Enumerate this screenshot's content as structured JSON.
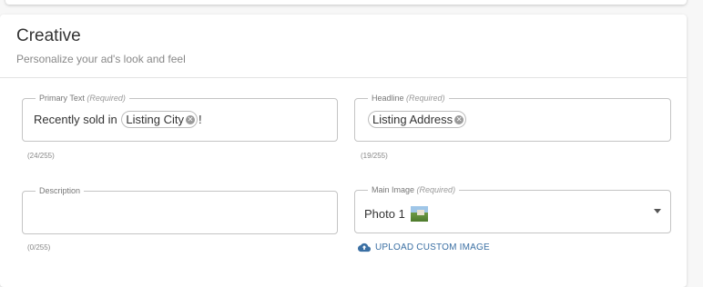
{
  "section": {
    "title": "Creative",
    "subtitle": "Personalize your ad's look and feel"
  },
  "primary_text": {
    "label": "Primary Text",
    "required": "(Required)",
    "prefix": "Recently sold in",
    "chip": "Listing City",
    "suffix": "!",
    "counter": "(24/255)"
  },
  "headline": {
    "label": "Headline",
    "required": "(Required)",
    "chip": "Listing Address",
    "counter": "(19/255)"
  },
  "description": {
    "label": "Description",
    "value": "",
    "counter": "(0/255)"
  },
  "main_image": {
    "label": "Main Image",
    "required": "(Required)",
    "selected": "Photo 1",
    "thumbnail_icon": "photo-thumbnail"
  },
  "upload": {
    "label": "UPLOAD CUSTOM IMAGE",
    "icon": "cloud-upload-icon",
    "color": "#3a6fa3"
  }
}
